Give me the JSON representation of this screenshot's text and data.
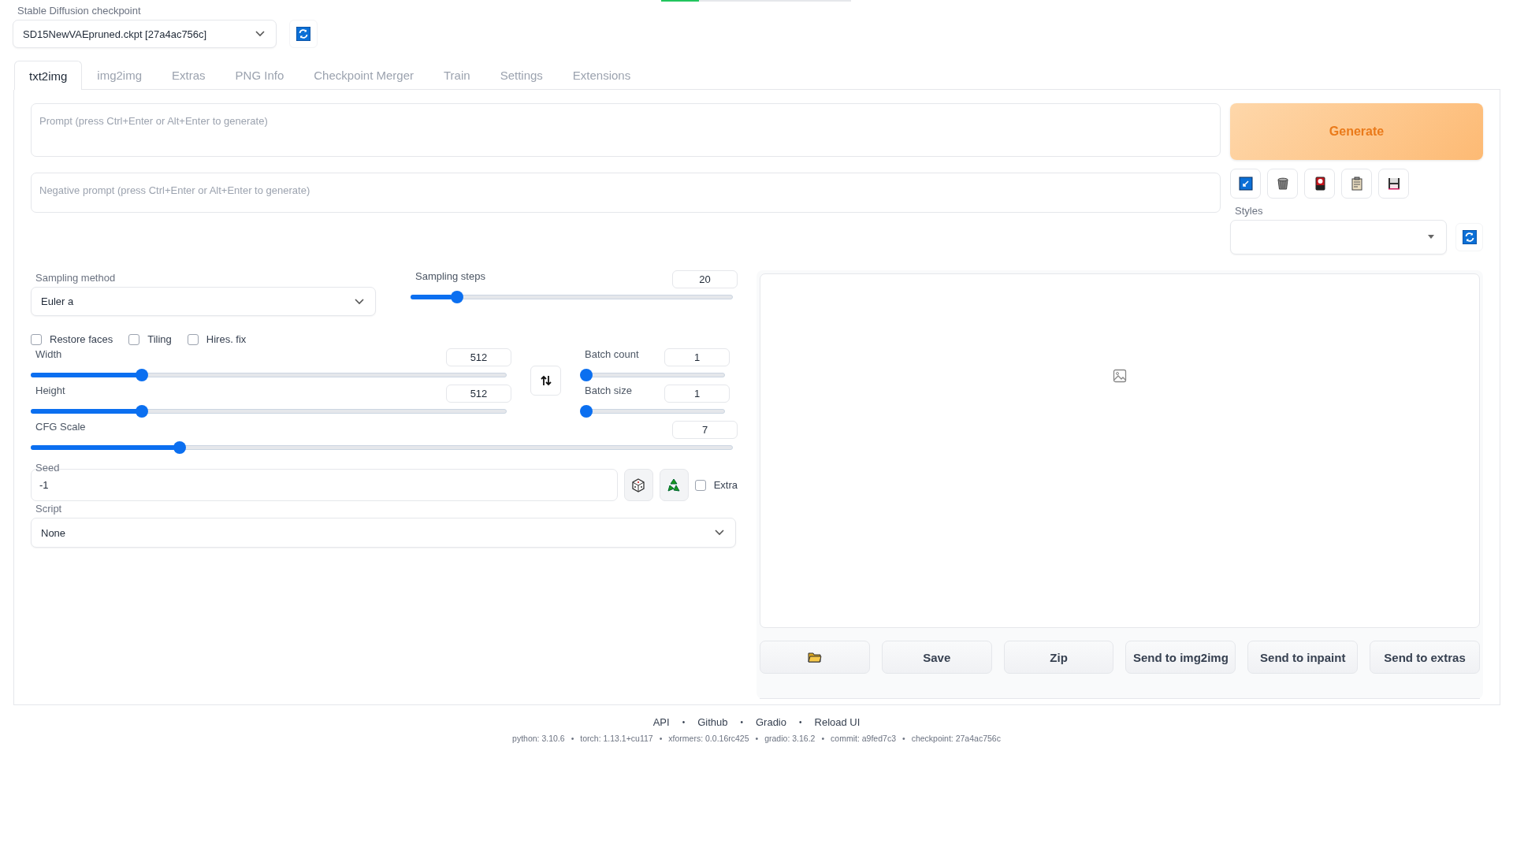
{
  "top_progress": {
    "level": 0.2
  },
  "checkpoint": {
    "label": "Stable Diffusion checkpoint",
    "value": "SD15NewVAEpruned.ckpt [27a4ac756c]"
  },
  "tabs": [
    {
      "label": "txt2img",
      "selected": true
    },
    {
      "label": "img2img",
      "selected": false
    },
    {
      "label": "Extras",
      "selected": false
    },
    {
      "label": "PNG Info",
      "selected": false
    },
    {
      "label": "Checkpoint Merger",
      "selected": false
    },
    {
      "label": "Train",
      "selected": false
    },
    {
      "label": "Settings",
      "selected": false
    },
    {
      "label": "Extensions",
      "selected": false
    }
  ],
  "prompt": {
    "placeholder": "Prompt (press Ctrl+Enter or Alt+Enter to generate)"
  },
  "negative_prompt": {
    "placeholder": "Negative prompt (press Ctrl+Enter or Alt+Enter to generate)"
  },
  "generate_button": "Generate",
  "styles": {
    "label": "Styles"
  },
  "sampling_method": {
    "label": "Sampling method",
    "value": "Euler a"
  },
  "sampling_steps": {
    "label": "Sampling steps",
    "value": "20",
    "level": 0.13
  },
  "checkboxes": [
    {
      "label": "Restore faces",
      "checked": false
    },
    {
      "label": "Tiling",
      "checked": false
    },
    {
      "label": "Hires. fix",
      "checked": false
    }
  ],
  "width": {
    "label": "Width",
    "value": "512",
    "level": 0.226
  },
  "height": {
    "label": "Height",
    "value": "512",
    "level": 0.226
  },
  "batch_count": {
    "label": "Batch count",
    "value": "1",
    "level": 0
  },
  "batch_size": {
    "label": "Batch size",
    "value": "1",
    "level": 0
  },
  "cfg_scale": {
    "label": "CFG Scale",
    "value": "7",
    "level": 0.207
  },
  "seed": {
    "label": "Seed",
    "value": "-1"
  },
  "extra": {
    "label": "Extra",
    "checked": false
  },
  "script": {
    "label": "Script",
    "value": "None"
  },
  "output_buttons": [
    "Save",
    "Zip",
    "Send to img2img",
    "Send to inpaint",
    "Send to extras"
  ],
  "footer_separator": "•",
  "footer_links": [
    "API",
    "Github",
    "Gradio",
    "Reload UI"
  ],
  "footer_info": [
    "python: 3.10.6",
    "torch: 1.13.1+cu117",
    "xformers: 0.0.16rc425",
    "gradio: 3.16.2",
    "commit: a9fed7c3",
    "checkpoint: 27a4ac756c"
  ]
}
